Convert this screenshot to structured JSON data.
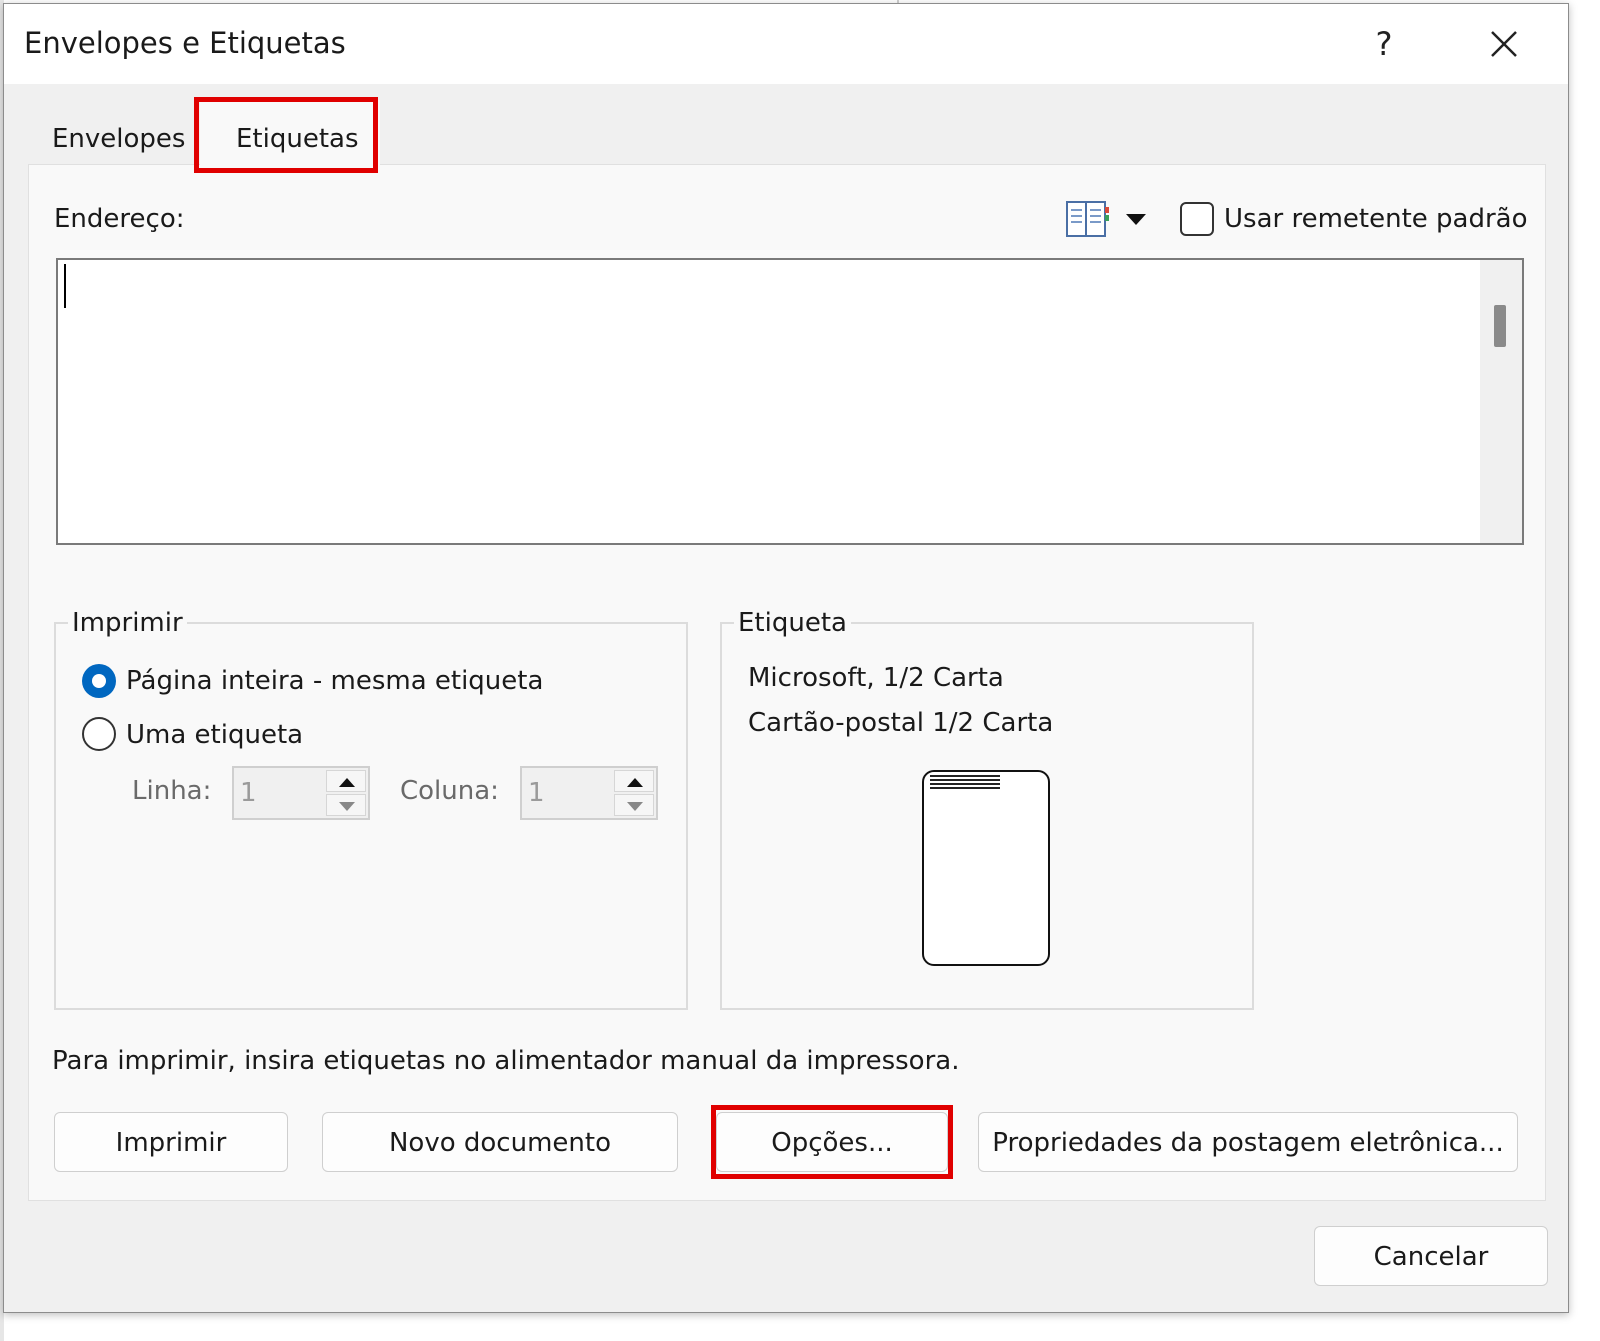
{
  "dialog": {
    "title": "Envelopes e Etiquetas",
    "help_label": "?",
    "close_icon": "close-icon"
  },
  "tabs": [
    {
      "label": "Envelopes",
      "active": false
    },
    {
      "label": "Etiquetas",
      "active": true
    }
  ],
  "address": {
    "label": "Endereço:",
    "value": "",
    "address_book_icon": "address-book-icon",
    "dropdown_icon": "chevron-down-icon",
    "use_default_sender": {
      "label": "Usar remetente padrão",
      "checked": false
    }
  },
  "print_group": {
    "title": "Imprimir",
    "options": [
      {
        "label": "Página inteira - mesma etiqueta",
        "checked": true
      },
      {
        "label": "Uma etiqueta",
        "checked": false
      }
    ],
    "row_label": "Linha:",
    "row_value": "1",
    "col_label": "Coluna:",
    "col_value": "1"
  },
  "label_group": {
    "title": "Etiqueta",
    "vendor": "Microsoft, 1/2 Carta",
    "product": "Cartão-postal 1/2 Carta"
  },
  "hint": "Para imprimir, insira etiquetas no alimentador manual da impressora.",
  "buttons": {
    "print": "Imprimir",
    "new_document": "Novo documento",
    "options": "Opções...",
    "epostage": "Propriedades da postagem eletrônica...",
    "cancel": "Cancelar"
  },
  "colors": {
    "accent": "#0067c0",
    "annotation": "#e00000"
  }
}
